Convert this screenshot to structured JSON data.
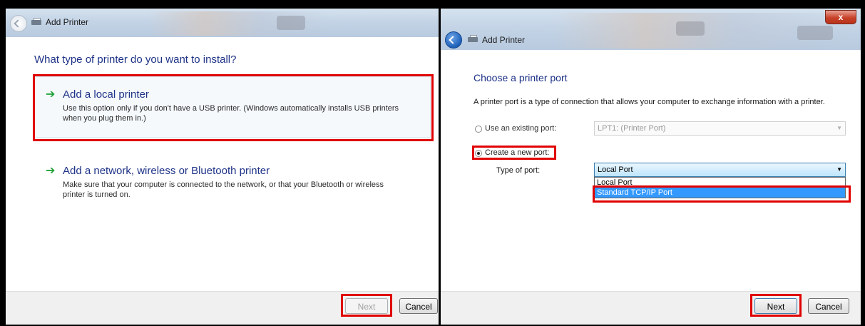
{
  "left_window": {
    "title": "Add Printer",
    "heading": "What type of printer do you want to install?",
    "options": [
      {
        "title": "Add a local printer",
        "description_line1": "Use this option only if you don't have a USB printer. (Windows automatically installs USB printers",
        "description_line2": "when you plug them in.)"
      },
      {
        "title": "Add a network, wireless or Bluetooth printer",
        "description_line1": "Make sure that your computer is connected to the network, or that your Bluetooth or wireless",
        "description_line2": "printer is turned on."
      }
    ],
    "next_label": "Next",
    "cancel_label": "Cancel"
  },
  "right_window": {
    "title": "Add Printer",
    "close_glyph": "x",
    "heading": "Choose a printer port",
    "description": "A printer port is a type of connection that allows your computer to exchange information with a printer.",
    "existing_port_label": "Use an existing port:",
    "existing_port_value": "LPT1: (Printer Port)",
    "new_port_label": "Create a new port:",
    "type_of_port_label": "Type of port:",
    "type_of_port_value": "Local Port",
    "dropdown_options": [
      "Local Port",
      "Standard TCP/IP Port"
    ],
    "next_label": "Next",
    "cancel_label": "Cancel"
  },
  "icons": {
    "back": "back-arrow-icon",
    "printer": "printer-icon",
    "option_arrow": "green-arrow-icon",
    "dropdown": "chevron-down-icon",
    "close": "close-icon"
  },
  "colors": {
    "highlight": "#e00000",
    "heading": "#1e3287",
    "arrow": "#23a23a",
    "selection": "#3399ff"
  }
}
